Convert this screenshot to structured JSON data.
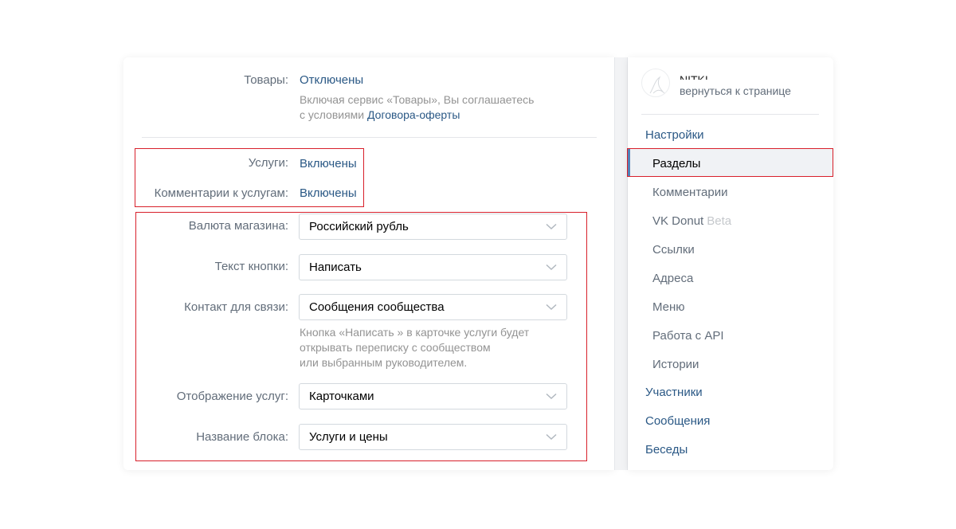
{
  "main": {
    "goods": {
      "label": "Товары:",
      "value": "Отключены",
      "hint_line1": "Включая сервис «Товары», Вы соглашаетесь",
      "hint_line2_prefix": "с условиями ",
      "hint_link": "Договора-оферты"
    },
    "services": {
      "label": "Услуги:",
      "value": "Включены"
    },
    "service_comments": {
      "label": "Комментарии к услугам:",
      "value": "Включены"
    },
    "currency": {
      "label": "Валюта магазина:",
      "value": "Российский рубль"
    },
    "button_text": {
      "label": "Текст кнопки:",
      "value": "Написать"
    },
    "contact": {
      "label": "Контакт для связи:",
      "value": "Сообщения сообщества",
      "hint_line1": "Кнопка «Написать » в карточке услуги будет",
      "hint_line2": "открывать переписку с сообществом",
      "hint_line3": "или выбранным руководителем."
    },
    "display": {
      "label": "Отображение услуг:",
      "value": "Карточками"
    },
    "block_name": {
      "label": "Название блока:",
      "value": "Услуги и цены"
    }
  },
  "sidebar": {
    "group_name": "NITKI",
    "back_link": "вернуться к странице",
    "settings_label": "Настройки",
    "items": [
      {
        "label": "Разделы"
      },
      {
        "label": "Комментарии"
      },
      {
        "label": "VK Donut",
        "badge": "Beta"
      },
      {
        "label": "Ссылки"
      },
      {
        "label": "Адреса"
      },
      {
        "label": "Меню"
      },
      {
        "label": "Работа с API"
      },
      {
        "label": "Истории"
      }
    ],
    "members_label": "Участники",
    "messages_label": "Сообщения",
    "chats_label": "Беседы"
  },
  "colors": {
    "link": "#2a5885",
    "highlight": "#d8202b",
    "active_bar": "#5181b8",
    "muted": "#626d7a"
  }
}
